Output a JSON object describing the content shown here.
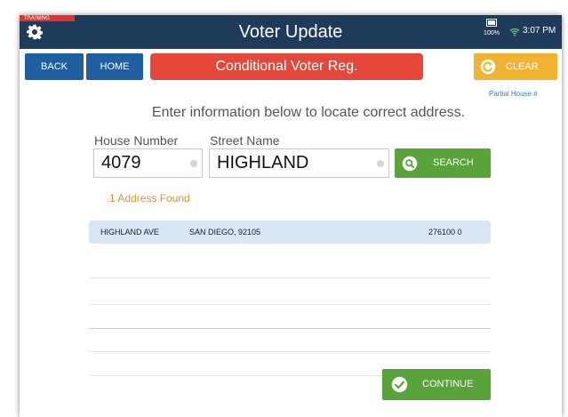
{
  "status_bar": {
    "training_label": "TRAINING",
    "app_title": "Voter Update",
    "battery_percent": "100%",
    "time": "3:07 PM"
  },
  "nav": {
    "back_label": "BACK",
    "home_label": "HOME",
    "banner_label": "Conditional Voter Reg.",
    "clear_label": "CLEAR",
    "partial_house_link": "Partial House #"
  },
  "form": {
    "instructions": "Enter information below to locate correct address.",
    "house_number_label": "House Number",
    "house_number_value": "4079",
    "street_name_label": "Street Name",
    "street_name_value": "HIGHLAND",
    "search_label": "SEARCH"
  },
  "results": {
    "found_text": "1 Address Found",
    "rows": [
      {
        "street": "HIGHLAND AVE",
        "city": "SAN DIEGO, 92105",
        "precinct": "276100  0"
      }
    ]
  },
  "footer": {
    "continue_label": "CONTINUE"
  },
  "colors": {
    "titlebar": "#1f3b5c",
    "nav_button": "#1f5f9f",
    "banner": "#e6473b",
    "clear_button": "#f2b233",
    "action_green": "#58a43a",
    "found_text": "#e38f2d",
    "selected_row": "#d8e6f4"
  },
  "icons": {
    "settings": "gear-icon",
    "clear": "refresh-icon",
    "search": "search-icon",
    "continue": "check-icon",
    "wifi": "wifi-icon",
    "battery": "battery-icon"
  }
}
